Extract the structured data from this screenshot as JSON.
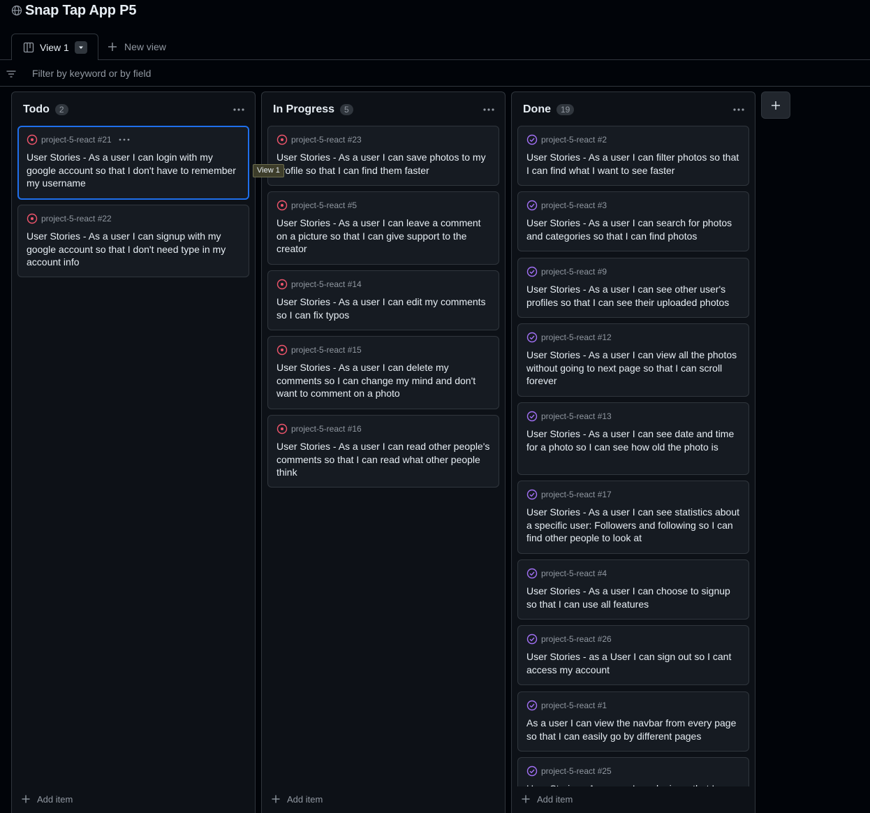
{
  "project": {
    "title": "Snap Tap App P5",
    "icon": "globe-icon"
  },
  "tabs": {
    "active": {
      "label": "View 1",
      "icon": "project-board-icon"
    },
    "new_view_label": "New view"
  },
  "filter": {
    "placeholder": "Filter by keyword or by field"
  },
  "tooltip": "View 1",
  "add_item_label": "Add item",
  "colors": {
    "open": "#f0556c",
    "done": "#a371f7",
    "selected_border": "#1f6feb",
    "background": "#010409",
    "column_bg": "#0d1117",
    "card_bg": "#161b22"
  },
  "columns": [
    {
      "name": "Todo",
      "count": "2",
      "cards": [
        {
          "ref": "project-5-react #21",
          "status": "open",
          "selected": true,
          "text": "User Stories - As a user I can login with my google account so that I don't have to remember my username"
        },
        {
          "ref": "project-5-react #22",
          "status": "open",
          "text": "User Stories - As a user I can signup with my google account so that I don't need type in my account info"
        }
      ]
    },
    {
      "name": "In Progress",
      "count": "5",
      "cards": [
        {
          "ref": "project-5-react #23",
          "status": "open",
          "text": "User Stories - As a user I can save photos to my profile so that I can find them faster"
        },
        {
          "ref": "project-5-react #5",
          "status": "open",
          "text": "User Stories - As a user I can leave a comment on a picture so that I can give support to the creator"
        },
        {
          "ref": "project-5-react #14",
          "status": "open",
          "text": "User Stories - As a user I can edit my comments so I can fix typos"
        },
        {
          "ref": "project-5-react #15",
          "status": "open",
          "text": "User Stories - As a user I can delete my comments so I can change my mind and don't want to comment on a photo"
        },
        {
          "ref": "project-5-react #16",
          "status": "open",
          "text": "User Stories - As a user I can read other people's comments so that I can read what other people think"
        }
      ]
    },
    {
      "name": "Done",
      "count": "19",
      "cards": [
        {
          "ref": "project-5-react #2",
          "status": "done",
          "text": "User Stories - As a user I can filter photos so that I can find what I want to see faster"
        },
        {
          "ref": "project-5-react #3",
          "status": "done",
          "text": "User Stories - As a user I can search for photos and categories so that I can find photos"
        },
        {
          "ref": "project-5-react #9",
          "status": "done",
          "text": "User Stories - As a user I can see other user's profiles so that I can see their uploaded photos"
        },
        {
          "ref": "project-5-react #12",
          "status": "done",
          "text": "User Stories - As a user I can view all the photos without going to next page so that I can scroll forever"
        },
        {
          "ref": "project-5-react #13",
          "status": "done",
          "text": "User Stories - As a user I can see date and time for a photo so I can see how old the photo is"
        },
        {
          "ref": "project-5-react #17",
          "status": "done",
          "text": "User Stories - As a user I can see statistics about a specific user: Followers and following so I can find other people to look at"
        },
        {
          "ref": "project-5-react #4",
          "status": "done",
          "text": "User Stories - As a user I can choose to signup so that I can use all features"
        },
        {
          "ref": "project-5-react #26",
          "status": "done",
          "text": "User Stories - as a User I can sign out so I cant access my account"
        },
        {
          "ref": "project-5-react #1",
          "status": "done",
          "text": "As a user I can view the navbar from every page so that I can easily go by different pages"
        },
        {
          "ref": "project-5-react #25",
          "status": "done",
          "text": "User Stories - As a user I can login so that I can access my account"
        }
      ]
    }
  ]
}
